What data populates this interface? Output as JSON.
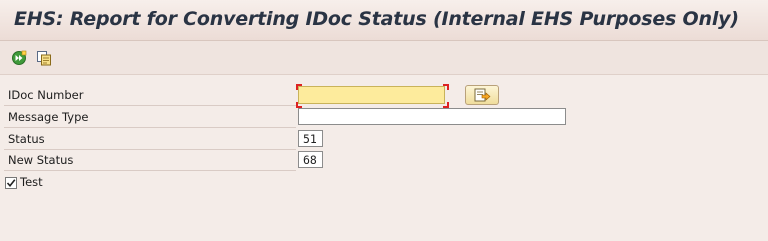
{
  "window": {
    "title": "EHS: Report for Converting IDoc Status (Internal EHS Purposes Only)"
  },
  "toolbar": {
    "buttons": [
      {
        "icon": "execute-icon"
      },
      {
        "icon": "get-variant-icon"
      }
    ]
  },
  "form": {
    "idoc_number": {
      "label": "IDoc Number",
      "value": "",
      "required": true
    },
    "message_type": {
      "label": "Message Type",
      "value": ""
    },
    "status": {
      "label": "Status",
      "value": "51"
    },
    "new_status": {
      "label": "New Status",
      "value": "68"
    },
    "test": {
      "label": "Test",
      "checked": true
    }
  },
  "colors": {
    "background": "#f4ece8",
    "title_text": "#2a3444",
    "required_field": "#fdeb9c"
  }
}
